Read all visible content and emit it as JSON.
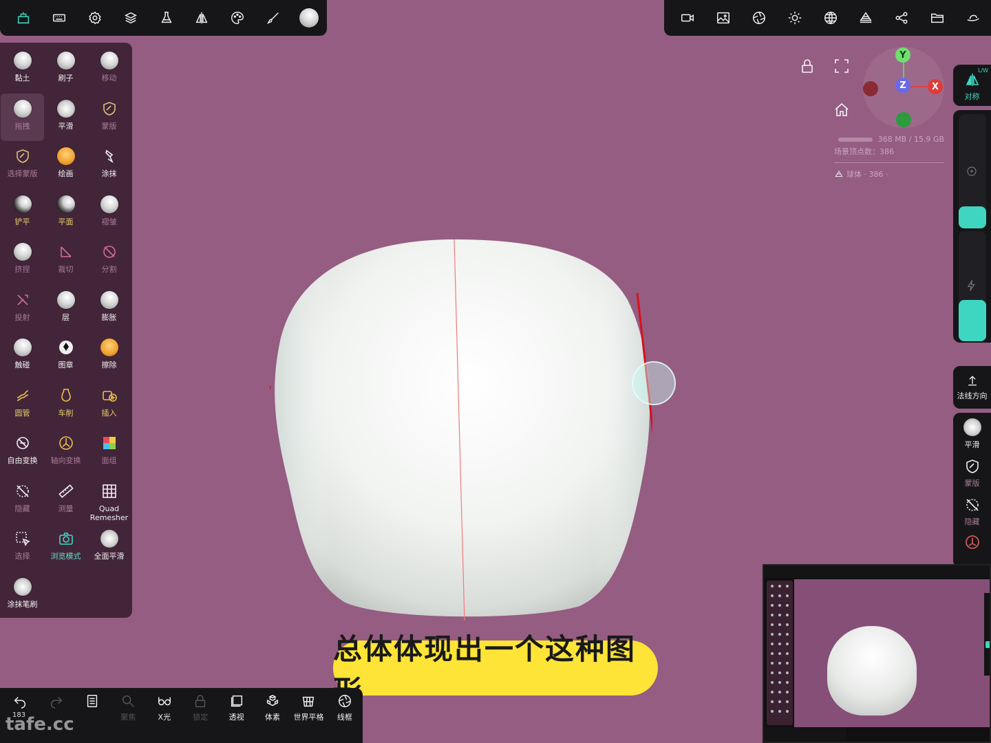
{
  "top_toolbar_left": {
    "icons": [
      "app-icon",
      "keyboard-icon",
      "settings-icon",
      "layers-icon",
      "flask-icon",
      "symmetry-icon",
      "palette-icon",
      "brush-icon",
      "material-sphere-icon"
    ]
  },
  "top_toolbar_right": {
    "icons": [
      "camera-icon",
      "image-icon",
      "aperture-icon",
      "light-icon",
      "globe-icon",
      "scene-icon",
      "share-icon",
      "folder-icon",
      "hat-icon"
    ]
  },
  "tools": [
    {
      "label": "黏土",
      "icon": "sphere",
      "style": "normal"
    },
    {
      "label": "刷子",
      "icon": "sphere",
      "style": "normal"
    },
    {
      "label": "移动",
      "icon": "sphere",
      "style": "dim"
    },
    {
      "label": "拖拽",
      "icon": "sphere",
      "style": "dim",
      "selected": true
    },
    {
      "label": "平滑",
      "icon": "spiky",
      "style": "normal"
    },
    {
      "label": "蒙版",
      "icon": "shield",
      "style": "dim"
    },
    {
      "label": "选择蒙版",
      "icon": "shield",
      "style": "dim"
    },
    {
      "label": "绘画",
      "icon": "orange",
      "style": "normal"
    },
    {
      "label": "涂抹",
      "icon": "smudge",
      "style": "normal"
    },
    {
      "label": "铲平",
      "icon": "dark",
      "style": "yellow"
    },
    {
      "label": "平面",
      "icon": "dark",
      "style": "yellow"
    },
    {
      "label": "褶皱",
      "icon": "sphere",
      "style": "dim"
    },
    {
      "label": "挤捏",
      "icon": "sphere",
      "style": "dim"
    },
    {
      "label": "裁切",
      "icon": "cut",
      "style": "dim"
    },
    {
      "label": "分割",
      "icon": "split",
      "style": "dim"
    },
    {
      "label": "投射",
      "icon": "project",
      "style": "dim"
    },
    {
      "label": "层",
      "icon": "sphere",
      "style": "normal"
    },
    {
      "label": "膨胀",
      "icon": "sphere",
      "style": "normal"
    },
    {
      "label": "触碰",
      "icon": "sphere",
      "style": "normal"
    },
    {
      "label": "图章",
      "icon": "stamp",
      "style": "normal"
    },
    {
      "label": "擦除",
      "icon": "orange",
      "style": "normal"
    },
    {
      "label": "圆管",
      "icon": "tube",
      "style": "yellow"
    },
    {
      "label": "车削",
      "icon": "lathe",
      "style": "yellow"
    },
    {
      "label": "插入",
      "icon": "insert",
      "style": "yellow"
    },
    {
      "label": "自由变换",
      "icon": "transform",
      "style": "normal"
    },
    {
      "label": "轴向变换",
      "icon": "gizmo",
      "style": "dim"
    },
    {
      "label": "面组",
      "icon": "facegroup",
      "style": "dim"
    },
    {
      "label": "隐藏",
      "icon": "hide",
      "style": "dim"
    },
    {
      "label": "测量",
      "icon": "ruler",
      "style": "dim"
    },
    {
      "label": "Quad\nRemesher",
      "icon": "grid",
      "style": "normal"
    },
    {
      "label": "选择",
      "icon": "select",
      "style": "dim"
    },
    {
      "label": "浏览模式",
      "icon": "camera",
      "style": "teal"
    },
    {
      "label": "全面平滑",
      "icon": "spiky",
      "style": "normal"
    },
    {
      "label": "涂抹笔刷",
      "icon": "spiky",
      "style": "normal"
    }
  ],
  "bottom_bar": {
    "undo_count": "183",
    "items": [
      {
        "label": "",
        "icon": "undo-icon",
        "dim": false
      },
      {
        "label": "",
        "icon": "redo-icon",
        "dim": true
      },
      {
        "label": "",
        "icon": "layers-list-icon",
        "dim": false
      },
      {
        "label": "聚焦",
        "icon": "search-icon",
        "dim": true
      },
      {
        "label": "X光",
        "icon": "xray-glasses-icon",
        "dim": false
      },
      {
        "label": "锁定",
        "icon": "lock-icon",
        "dim": true
      },
      {
        "label": "透视",
        "icon": "perspective-icon",
        "dim": false
      },
      {
        "label": "体素",
        "icon": "voxel-icon",
        "dim": false
      },
      {
        "label": "世界平格",
        "icon": "world-grid-icon",
        "dim": false
      },
      {
        "label": "线框",
        "icon": "wireframe-icon",
        "dim": false
      }
    ]
  },
  "watermark": "tafe.cc",
  "viewport": {
    "gizmo": {
      "y": "Y",
      "z": "Z",
      "x": "X"
    },
    "memory": "368 MB / 15.9 GB",
    "vertices": "场景顶点数：386",
    "object": "球体 · 386 ·"
  },
  "right_panel": {
    "symmetry_label": "对称",
    "symmetry_badge": "L/W",
    "normal_direction_label": "法线方向",
    "smooth_label": "平滑",
    "mask_label": "蒙版",
    "hide_label": "隐藏"
  },
  "subtitle": "总体体现出一个这种图形",
  "colors": {
    "viewport_bg": "#955d82",
    "panel_bg": "#43253a",
    "toolbar_bg": "#161618",
    "accent": "#3fd6c1",
    "subtitle_bg": "#fde437"
  }
}
